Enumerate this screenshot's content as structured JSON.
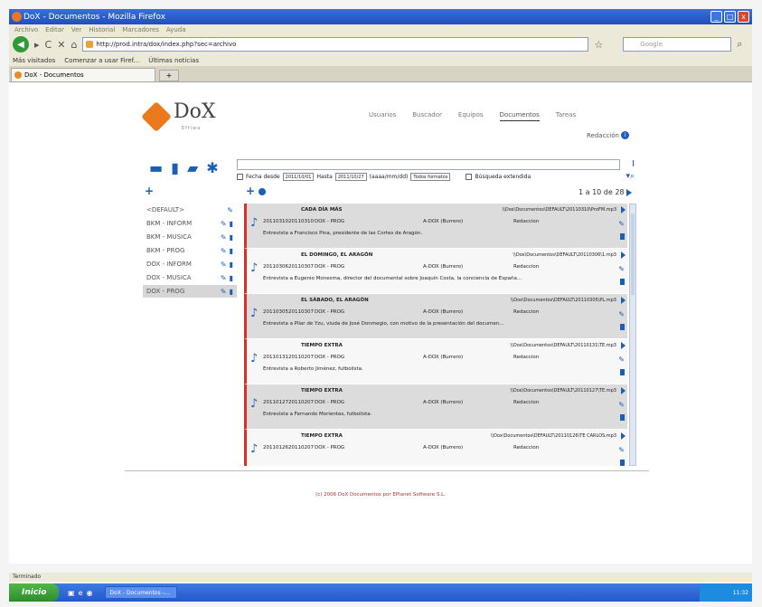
{
  "window": {
    "title": "DoX - Documentos - Mozilla Firefox",
    "controls": [
      "_",
      "□",
      "x"
    ]
  },
  "menubar": [
    "Archivo",
    "Editar",
    "Ver",
    "Historial",
    "Marcadores",
    "Ayuda"
  ],
  "navbar": {
    "url": "http://prod.intra/dox/index.php?sec=archivo",
    "search_placeholder": "Google"
  },
  "bookmarks": [
    "Más visitados",
    "Comenzar a usar Firef...",
    "Últimas noticias"
  ],
  "tabs": [
    {
      "label": "DoX - Documentos"
    }
  ],
  "tab_new": "+",
  "logo": {
    "name": "DoX",
    "sub": "Effiwa"
  },
  "topnav": [
    "Usuarios",
    "Buscador",
    "Equipos",
    "Documentos",
    "Tareas"
  ],
  "topnav_active": "Documentos",
  "user": {
    "name": "Redacción"
  },
  "filters": {
    "fecha_desde_label": "Fecha desde",
    "fecha_desde": "2011/10/01",
    "hasta_label": "Hasta",
    "hasta": "2011/10/27",
    "hasta_suffix": "(aaaa/mm/dd)",
    "formato": "Todos formatos",
    "extendida_label": "Búsqueda extendida"
  },
  "pager": "1 a 10 de 28",
  "sidebar": [
    {
      "label": "<DEFAULT>",
      "active": false
    },
    {
      "label": "BKM - INFORM",
      "active": false
    },
    {
      "label": "BKM - MUSICA",
      "active": false
    },
    {
      "label": "BKM - PROG",
      "active": false
    },
    {
      "label": "DOX - INFORM",
      "active": false
    },
    {
      "label": "DOX - MUSICA",
      "active": false
    },
    {
      "label": "DOX - PROG",
      "active": true
    }
  ],
  "rows": [
    {
      "title": "CADA DÍA MÁS",
      "path": "\\\\Dox\\Documentos\\DEFAULT\\20110310\\ProFM.mp3",
      "c1": "20110310",
      "c2": "20110310",
      "c3": "DOX - PROG",
      "c4": "A-DOX (Burrero)",
      "c5": "Redaccion",
      "desc": "Entrevista a Francisco Pina, presidente de las Cortes de Aragón.",
      "shade": "gray"
    },
    {
      "title": "EL DOMINGO, EL ARAGÓN",
      "path": "\\\\Dox\\Documentos\\DEFAULT\\20110306\\1.mp3",
      "c1": "20110306",
      "c2": "20110307",
      "c3": "DOX - PROG",
      "c4": "A-DOX (Burrero)",
      "c5": "Redaccion",
      "desc": "Entrevista a Eugenio Monesma, director del documental sobre Joaquín Costa, la conciencia de España...",
      "shade": "white"
    },
    {
      "title": "EL SÁBADO, EL ARAGÓN",
      "path": "\\\\Dox\\Documentos\\DEFAULT\\20110305\\PL.mp3",
      "c1": "20110305",
      "c2": "20110307",
      "c3": "DOX - PROG",
      "c4": "A-DOX (Burrero)",
      "c5": "Redaccion",
      "desc": "Entrevista a Pilar de Yzu, viuda de José Donmegio, con motivo de la presentación del documen...",
      "shade": "gray"
    },
    {
      "title": "TIEMPO EXTRA",
      "path": "\\\\Dox\\Documentos\\DEFAULT\\20110131\\TE.mp3",
      "c1": "20110131",
      "c2": "20110207",
      "c3": "DOX - PROG",
      "c4": "A-DOX (Burrero)",
      "c5": "Redaccion",
      "desc": "Entrevista a Roberto Jiménez, futbolista.",
      "shade": "white"
    },
    {
      "title": "TIEMPO EXTRA",
      "path": "\\\\Dox\\Documentos\\DEFAULT\\20110127\\TE.mp3",
      "c1": "20110127",
      "c2": "20110207",
      "c3": "DOX - PROG",
      "c4": "A-DOX (Burrero)",
      "c5": "Redaccion",
      "desc": "Entrevista a Fernando Morientes, futbolista.",
      "shade": "gray"
    },
    {
      "title": "TIEMPO EXTRA",
      "path": "\\\\Dox\\Documentos\\DEFAULT\\20110126\\TE CARLOS.mp3",
      "c1": "20110126",
      "c2": "20110207",
      "c3": "DOX - PROG",
      "c4": "A-DOX (Burrero)",
      "c5": "Redaccion",
      "desc": "",
      "shade": "white"
    }
  ],
  "footer": "(c) 2006 DoX Documentos por EPlanet Software S.L.",
  "statusbar": "Terminado",
  "taskbar": {
    "start": "Inicio",
    "item": "DoX - Documentos -...",
    "clock": "11:32"
  },
  "colors": {
    "accent": "#1a5fb4",
    "row_marker": "#d9302a",
    "logo": "#ea7a1c"
  }
}
